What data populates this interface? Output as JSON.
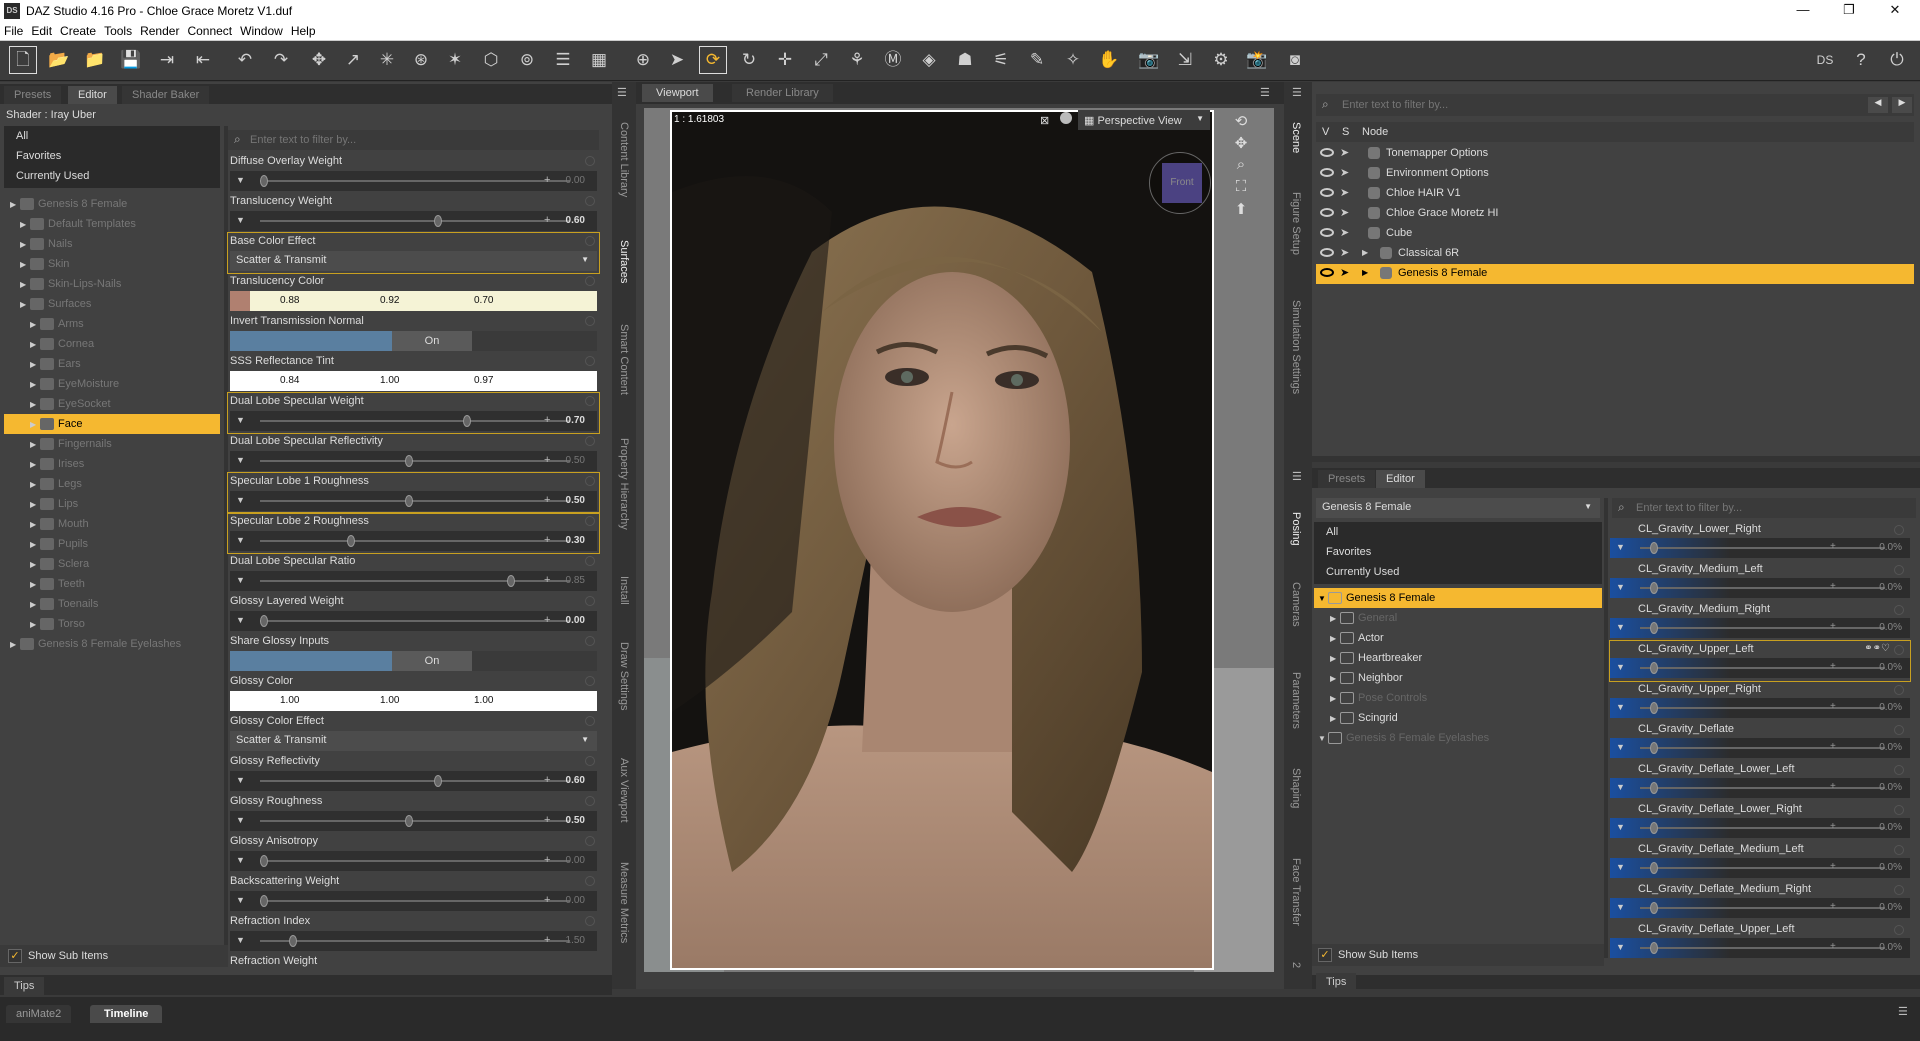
{
  "window": {
    "title": "DAZ Studio 4.16 Pro - Chloe Grace Moretz V1.duf",
    "app_icon": "DS"
  },
  "menu": [
    "File",
    "Edit",
    "Create",
    "Tools",
    "Render",
    "Connect",
    "Window",
    "Help"
  ],
  "left_panel": {
    "tabs": [
      "Presets",
      "Editor",
      "Shader Baker"
    ],
    "shader_label": "Shader : Iray Uber",
    "filter_placeholder": "Enter text to filter by...",
    "categories": [
      "All",
      "Favorites",
      "Currently Used"
    ],
    "tree": [
      {
        "label": "Genesis 8 Female",
        "level": 0
      },
      {
        "label": "Default Templates",
        "level": 1
      },
      {
        "label": "Nails",
        "level": 1
      },
      {
        "label": "Skin",
        "level": 1
      },
      {
        "label": "Skin-Lips-Nails",
        "level": 1
      },
      {
        "label": "Surfaces",
        "level": 1
      },
      {
        "label": "Arms",
        "level": 2
      },
      {
        "label": "Cornea",
        "level": 2
      },
      {
        "label": "Ears",
        "level": 2
      },
      {
        "label": "EyeMoisture",
        "level": 2
      },
      {
        "label": "EyeSocket",
        "level": 2
      },
      {
        "label": "Face",
        "level": 2,
        "selected": true
      },
      {
        "label": "Fingernails",
        "level": 2
      },
      {
        "label": "Irises",
        "level": 2
      },
      {
        "label": "Legs",
        "level": 2
      },
      {
        "label": "Lips",
        "level": 2
      },
      {
        "label": "Mouth",
        "level": 2
      },
      {
        "label": "Pupils",
        "level": 2
      },
      {
        "label": "Sclera",
        "level": 2
      },
      {
        "label": "Teeth",
        "level": 2
      },
      {
        "label": "Toenails",
        "level": 2
      },
      {
        "label": "Torso",
        "level": 2
      },
      {
        "label": "Genesis 8 Female Eyelashes",
        "level": 0
      }
    ],
    "show_sub_items": "Show Sub Items",
    "tips": "Tips"
  },
  "properties": [
    {
      "label": "Diffuse Overlay Weight",
      "type": "slider",
      "value": "0.00",
      "pos": 0.0,
      "dim": true
    },
    {
      "label": "Translucency Weight",
      "type": "slider",
      "value": "0.60",
      "pos": 0.6
    },
    {
      "label": "Base Color Effect",
      "type": "combo",
      "value": "Scatter & Transmit",
      "hl": true
    },
    {
      "label": "Translucency Color",
      "type": "color",
      "values": [
        "0.88",
        "0.92",
        "0.70"
      ]
    },
    {
      "label": "Invert Transmission Normal",
      "type": "toggle",
      "value": "On"
    },
    {
      "label": "SSS Reflectance Tint",
      "type": "color",
      "values": [
        "0.84",
        "1.00",
        "0.97"
      ],
      "white": true
    },
    {
      "label": "Dual Lobe Specular Weight",
      "type": "slider",
      "value": "0.70",
      "pos": 0.7,
      "hl": true
    },
    {
      "label": "Dual Lobe Specular Reflectivity",
      "type": "slider",
      "value": "0.50",
      "pos": 0.5,
      "dim": true
    },
    {
      "label": "Specular Lobe 1 Roughness",
      "type": "slider",
      "value": "0.50",
      "pos": 0.5,
      "hl": true
    },
    {
      "label": "Specular Lobe 2 Roughness",
      "type": "slider",
      "value": "0.30",
      "pos": 0.3,
      "hl": true
    },
    {
      "label": "Dual Lobe Specular Ratio",
      "type": "slider",
      "value": "0.85",
      "pos": 0.85,
      "dim": true
    },
    {
      "label": "Glossy Layered Weight",
      "type": "slider",
      "value": "0.00",
      "pos": 0.0
    },
    {
      "label": "Share Glossy Inputs",
      "type": "toggle",
      "value": "On"
    },
    {
      "label": "Glossy Color",
      "type": "color",
      "values": [
        "1.00",
        "1.00",
        "1.00"
      ],
      "white": true
    },
    {
      "label": "Glossy Color Effect",
      "type": "combo",
      "value": "Scatter & Transmit"
    },
    {
      "label": "Glossy Reflectivity",
      "type": "slider",
      "value": "0.60",
      "pos": 0.6
    },
    {
      "label": "Glossy Roughness",
      "type": "slider",
      "value": "0.50",
      "pos": 0.5
    },
    {
      "label": "Glossy Anisotropy",
      "type": "slider",
      "value": "0.00",
      "pos": 0.0,
      "dim": true
    },
    {
      "label": "Backscattering Weight",
      "type": "slider",
      "value": "0.00",
      "pos": 0.0,
      "dim": true
    },
    {
      "label": "Refraction Index",
      "type": "slider",
      "value": "1.50",
      "pos": 0.1,
      "dim": true
    },
    {
      "label": "Refraction Weight",
      "type": "partial"
    }
  ],
  "left_vtabs": [
    "Content Library",
    "Surfaces",
    "Smart Content",
    "Property Hierarchy",
    "Install",
    "Draw Settings",
    "Aux Viewport",
    "Measure Metrics"
  ],
  "viewport": {
    "tabs": [
      "Viewport",
      "Render Library"
    ],
    "ratio": "1 : 1.61803",
    "view": "Perspective View",
    "cube_label": "Front"
  },
  "right_vtabs_top": [
    "Scene",
    "Figure Setup",
    "Simulation Settings"
  ],
  "right_vtabs_bottom": [
    "Posing",
    "Cameras",
    "Parameters",
    "Shaping",
    "Face Transfer",
    "2"
  ],
  "scene": {
    "filter_placeholder": "Enter text to filter by...",
    "headers": [
      "V",
      "S",
      "Node"
    ],
    "nodes": [
      {
        "label": "Tonemapper Options",
        "indent": 0
      },
      {
        "label": "Environment Options",
        "indent": 0
      },
      {
        "label": "Chloe HAIR V1",
        "indent": 0
      },
      {
        "label": "Chloe Grace Moretz HI",
        "indent": 0
      },
      {
        "label": "Cube",
        "indent": 0
      },
      {
        "label": "Classical 6R",
        "indent": 1
      },
      {
        "label": "Genesis 8 Female",
        "indent": 1,
        "selected": true
      }
    ]
  },
  "params": {
    "tabs": [
      "Presets",
      "Editor"
    ],
    "figure": "Genesis 8 Female",
    "filter_placeholder": "Enter text to filter by...",
    "categories": [
      "All",
      "Favorites",
      "Currently Used"
    ],
    "tree": [
      {
        "label": "Genesis 8 Female",
        "level": 0,
        "selected": true
      },
      {
        "label": "General",
        "level": 1,
        "dim": true
      },
      {
        "label": "Actor",
        "level": 1
      },
      {
        "label": "Heartbreaker",
        "level": 1
      },
      {
        "label": "Neighbor",
        "level": 1
      },
      {
        "label": "Pose Controls",
        "level": 1,
        "dim": true
      },
      {
        "label": "Scingrid",
        "level": 1
      },
      {
        "label": "Genesis 8 Female Eyelashes",
        "level": 0,
        "dim": true
      }
    ],
    "morphs": [
      {
        "label": "CL_Gravity_Lower_Right",
        "value": "0.0%"
      },
      {
        "label": "CL_Gravity_Medium_Left",
        "value": "0.0%"
      },
      {
        "label": "CL_Gravity_Medium_Right",
        "value": "0.0%"
      },
      {
        "label": "CL_Gravity_Upper_Left",
        "value": "0.0%",
        "hl": true
      },
      {
        "label": "CL_Gravity_Upper_Right",
        "value": "0.0%"
      },
      {
        "label": "CL_Gravity_Deflate",
        "value": "0.0%"
      },
      {
        "label": "CL_Gravity_Deflate_Lower_Left",
        "value": "0.0%"
      },
      {
        "label": "CL_Gravity_Deflate_Lower_Right",
        "value": "0.0%"
      },
      {
        "label": "CL_Gravity_Deflate_Medium_Left",
        "value": "0.0%"
      },
      {
        "label": "CL_Gravity_Deflate_Medium_Right",
        "value": "0.0%"
      },
      {
        "label": "CL_Gravity_Deflate_Upper_Left",
        "value": "0.0%"
      }
    ],
    "show_sub_items": "Show Sub Items",
    "tips": "Tips"
  },
  "bottom_tabs": [
    "aniMate2",
    "Timeline"
  ],
  "colors": {
    "accent": "#f5b830",
    "panel": "#414141",
    "dark": "#2e2e2e"
  }
}
